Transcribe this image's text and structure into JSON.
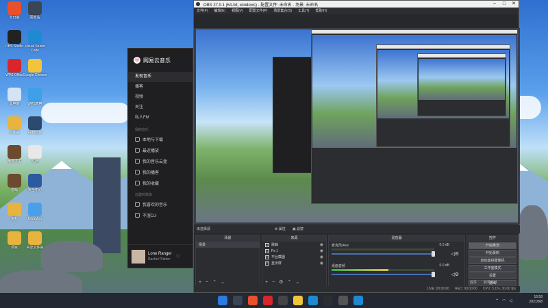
{
  "desktop": {
    "icons": [
      {
        "label": "向日葵",
        "color": "#e9502b"
      },
      {
        "label": "回收站",
        "color": "#3b4654"
      },
      {
        "label": "OBS Studio",
        "color": "#222222"
      },
      {
        "label": "Visual Studio Code",
        "color": "#1f8ad2"
      },
      {
        "label": "WPS Office",
        "color": "#d8262b"
      },
      {
        "label": "Google Chrome",
        "color": "#f2c43b"
      },
      {
        "label": "此电脑",
        "color": "#d4e4f4"
      },
      {
        "label": "WPS表格",
        "color": "#3da0e8"
      },
      {
        "label": "文件夹",
        "color": "#e8b440"
      },
      {
        "label": "控制面板",
        "color": "#2b4a6e"
      },
      {
        "label": "绝地求生",
        "color": "#6b4a2e"
      },
      {
        "label": "文档",
        "color": "#e8e8e8"
      },
      {
        "label": "游戏",
        "color": "#6b4a2e"
      },
      {
        "label": "安全中心",
        "color": "#2c5aa0"
      },
      {
        "label": "资料",
        "color": "#e8b440"
      },
      {
        "label": "UltraMon",
        "color": "#4aa0e8"
      },
      {
        "label": "项目",
        "color": "#e8b440"
      },
      {
        "label": "共享文件夹",
        "color": "#e8b440"
      }
    ]
  },
  "music": {
    "app_name": "网易云音乐",
    "nav": [
      "发现音乐",
      "播客",
      "视频",
      "关注",
      "私人FM"
    ],
    "section_label": "我的音乐",
    "my_music": [
      "本地与下载",
      "最近播放",
      "我的音乐云盘",
      "我的播客",
      "我的收藏"
    ],
    "playlist_section": "创建的歌单",
    "playlists": [
      "我喜欢的音乐",
      "不渣DJ-"
    ],
    "now_playing": {
      "title": "Lone Ranger",
      "artist": "Rachel Platten"
    }
  },
  "obs": {
    "title": "OBS 27.0.1 (64-bit, windows) - 配置文件: 未命名 - 场景: 未命名",
    "menus": [
      "文件(F)",
      "编辑(E)",
      "视图(V)",
      "配置文件(P)",
      "场景集合(S)",
      "工具(T)",
      "帮助(H)"
    ],
    "no_source": "未选择源",
    "props_label": "属性",
    "filters_label": "滤镜",
    "scenes_header": "场景",
    "scenes": [
      "场景"
    ],
    "sources_header": "来源",
    "sources": [
      {
        "icon": "T",
        "name": "歌曲"
      },
      {
        "icon": "▭",
        "name": "Ps 1"
      },
      {
        "icon": "▭",
        "name": "平台截图"
      },
      {
        "icon": "▭",
        "name": "显示屏"
      }
    ],
    "mixer_header": "混音器",
    "mixer": [
      {
        "name": "麦克风/Aux",
        "db": "0.0 dB",
        "level": 0.0
      },
      {
        "name": "桌面音频",
        "db": "0.0 dB",
        "level": 0.55
      }
    ],
    "controls_header": "控件",
    "controls": [
      "开始推流",
      "开始录制",
      "启动虚拟摄像机",
      "工作室模式",
      "设置",
      "退出"
    ],
    "controls_tabs": [
      "控件",
      "转场特效"
    ],
    "status": [
      "LIVE: 00:00:00",
      "REC: 00:00:00",
      "CPU: 5.1%, 30.00 fps"
    ]
  },
  "taskbar": {
    "time": "16:58",
    "date": "2021/8/8",
    "app_colors": [
      "#2b7be0",
      "#3b4654",
      "#e9502b",
      "#d8262b",
      "#444444",
      "#f2c43b",
      "#1f8ad2",
      "#2b2d31",
      "#555555",
      "#1f8ad2"
    ]
  }
}
